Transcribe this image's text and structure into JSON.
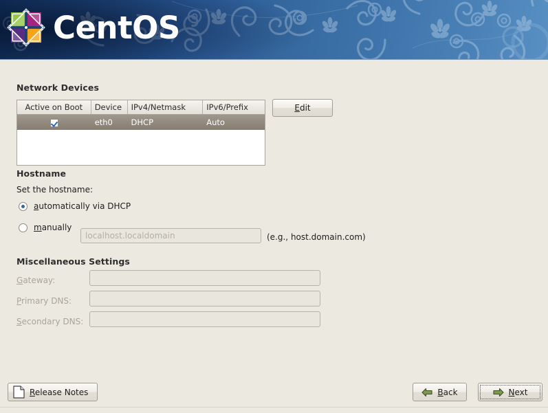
{
  "banner": {
    "product_name": "CentOS",
    "logo_colors": {
      "green": "#8fc63d",
      "magenta": "#a4247f",
      "violet": "#5a2d82",
      "orange": "#f5a31a"
    },
    "background_start": "#12305e",
    "background_end": "#5890c4"
  },
  "sections": {
    "network_devices": {
      "heading": "Network Devices",
      "columns": [
        "Active on Boot",
        "Device",
        "IPv4/Netmask",
        "IPv6/Prefix"
      ],
      "rows": [
        {
          "active_on_boot": true,
          "device": "eth0",
          "ipv4_netmask": "DHCP",
          "ipv6_prefix": "Auto",
          "selected": true
        }
      ],
      "edit_button": "Edit",
      "edit_button_mnemonic": "E"
    },
    "hostname": {
      "heading": "Hostname",
      "prompt": "Set the hostname:",
      "options": [
        {
          "label": "automatically via DHCP",
          "mnemonic": "a",
          "selected": true
        },
        {
          "label": "manually",
          "mnemonic": "m",
          "selected": false
        }
      ],
      "manual_field": {
        "value": "",
        "placeholder": "localhost.localdomain",
        "enabled": false
      },
      "example_hint": "(e.g., host.domain.com)"
    },
    "misc": {
      "heading": "Miscellaneous Settings",
      "fields": [
        {
          "label": "Gateway:",
          "mnemonic": "G",
          "value": "",
          "enabled": false
        },
        {
          "label": "Primary DNS:",
          "mnemonic": "P",
          "value": "",
          "enabled": false
        },
        {
          "label": "Secondary DNS:",
          "mnemonic": "S",
          "value": "",
          "enabled": false
        }
      ]
    }
  },
  "footer": {
    "release_notes": {
      "label": "Release Notes",
      "mnemonic": "R",
      "icon": "document-icon"
    },
    "back": {
      "label": "Back",
      "mnemonic": "B",
      "icon": "arrow-left-icon"
    },
    "next": {
      "label": "Next",
      "mnemonic": "N",
      "icon": "arrow-right-icon",
      "focused": true
    }
  }
}
